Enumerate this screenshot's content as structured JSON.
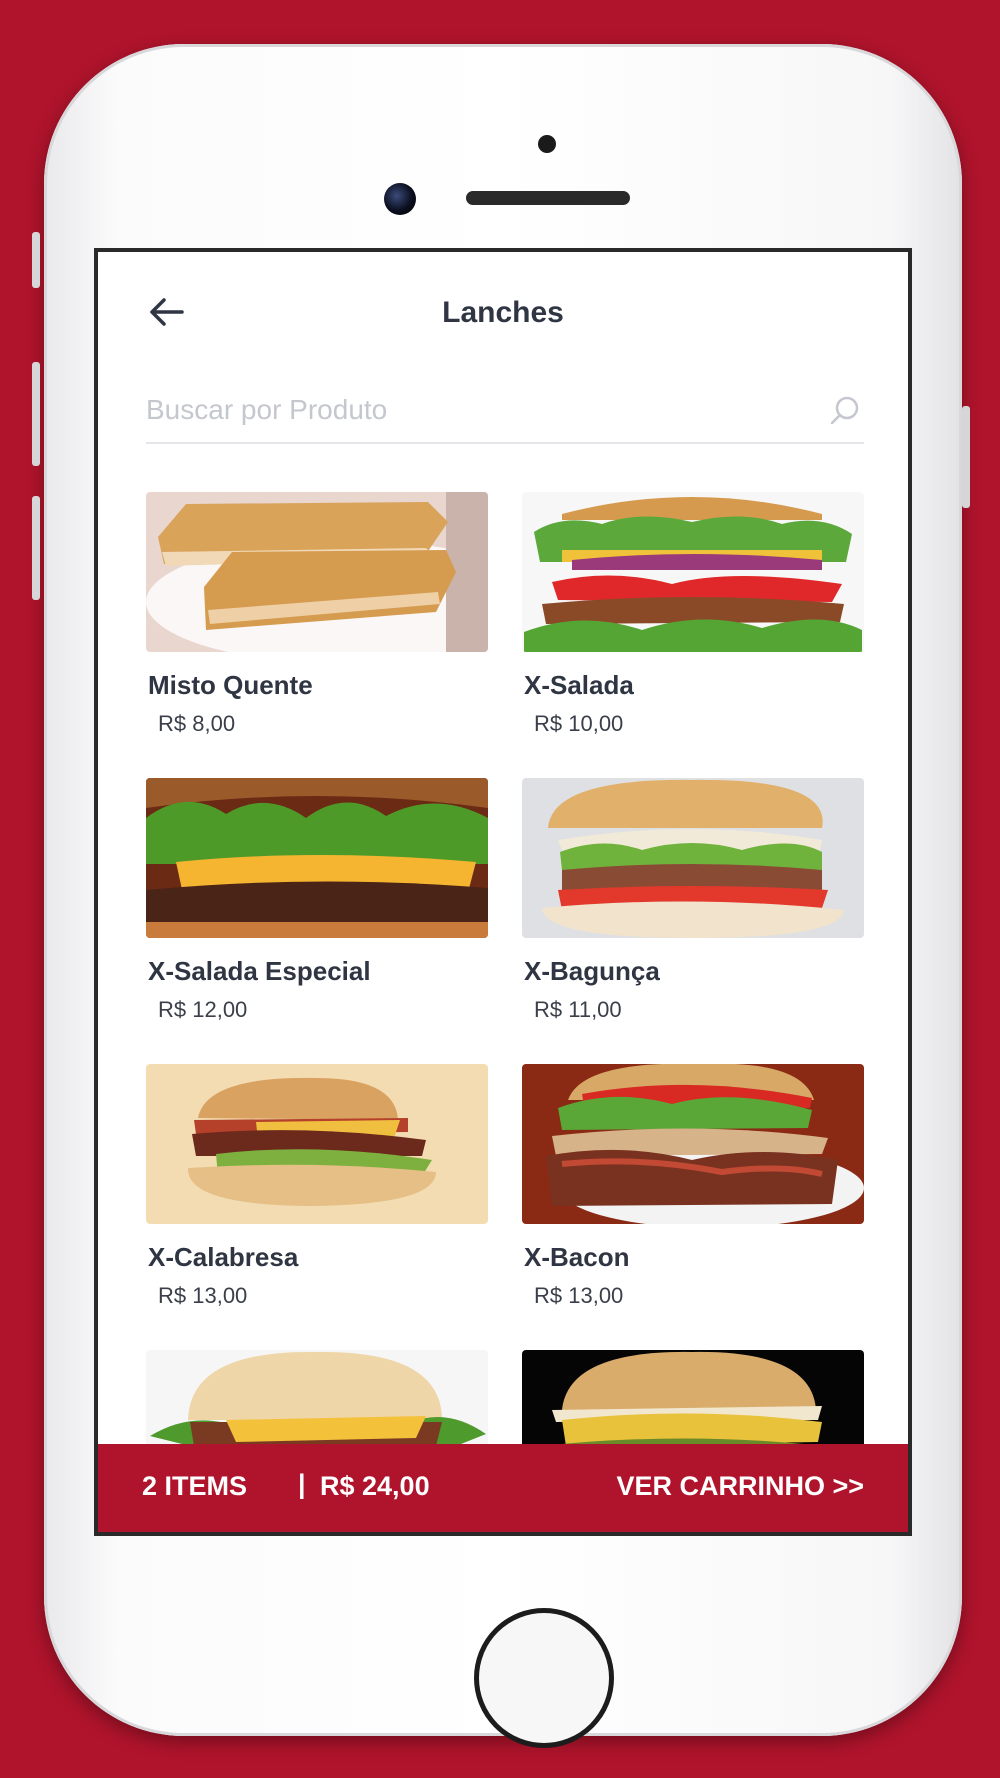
{
  "header": {
    "title": "Lanches",
    "back_icon": "arrow-left-icon"
  },
  "search": {
    "placeholder": "Buscar por Produto",
    "value": "",
    "icon": "search-icon"
  },
  "products": [
    {
      "name": "Misto Quente",
      "price": "R$ 8,00"
    },
    {
      "name": "X-Salada",
      "price": "R$ 10,00"
    },
    {
      "name": "X-Salada Especial",
      "price": "R$ 12,00"
    },
    {
      "name": "X-Bagunça",
      "price": "R$ 11,00"
    },
    {
      "name": "X-Calabresa",
      "price": "R$ 13,00"
    },
    {
      "name": "X-Bacon",
      "price": "R$ 13,00"
    }
  ],
  "cart": {
    "items_label": "2 ITEMS",
    "separator": "|",
    "total": "R$ 24,00",
    "cta": "VER CARRINHO >>"
  },
  "colors": {
    "brand": "#b0142c",
    "text": "#2f3542",
    "placeholder": "#c4c7cd"
  }
}
